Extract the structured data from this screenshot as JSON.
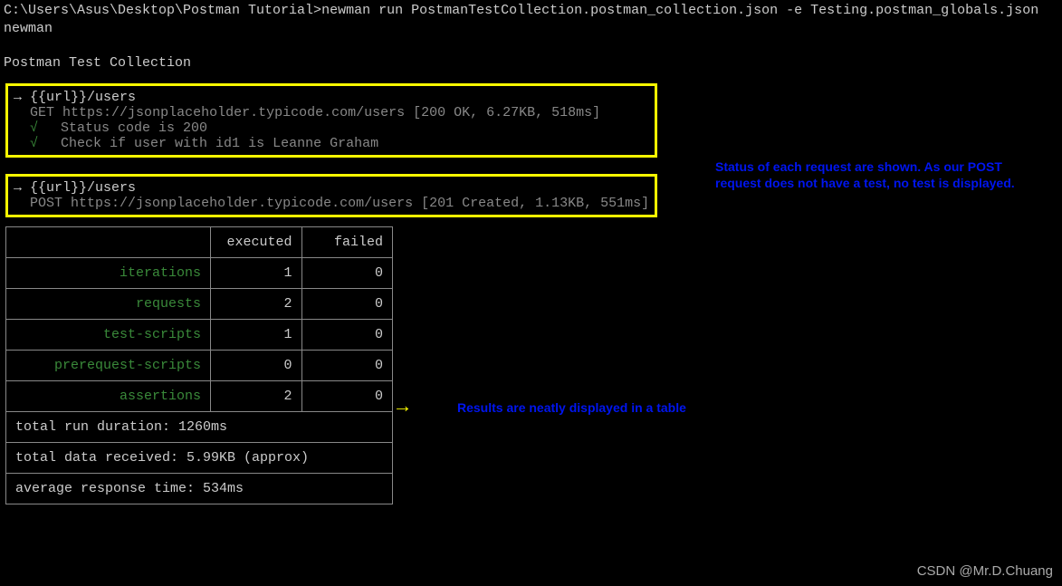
{
  "prompt": {
    "path": "C:\\Users\\Asus\\Desktop\\Postman Tutorial>",
    "command": "newman run PostmanTestCollection.postman_collection.json -e Testing.postman_globals.json",
    "tool": "newman"
  },
  "collection_title": "Postman Test Collection",
  "requests": [
    {
      "path_label": "→ {{url}}/users",
      "method": "GET",
      "url": "https://jsonplaceholder.typicode.com/users",
      "status": "[200 OK, 6.27KB, 518ms]",
      "tests": [
        "Status code is 200",
        "Check if user with id1 is Leanne Graham"
      ]
    },
    {
      "path_label": "→ {{url}}/users",
      "method": "POST",
      "url": "https://jsonplaceholder.typicode.com/users",
      "status": "[201 Created, 1.13KB, 551ms]",
      "tests": []
    }
  ],
  "table": {
    "header_executed": "executed",
    "header_failed": "failed",
    "rows": [
      {
        "label": "iterations",
        "executed": "1",
        "failed": "0"
      },
      {
        "label": "requests",
        "executed": "2",
        "failed": "0"
      },
      {
        "label": "test-scripts",
        "executed": "1",
        "failed": "0"
      },
      {
        "label": "prerequest-scripts",
        "executed": "0",
        "failed": "0"
      },
      {
        "label": "assertions",
        "executed": "2",
        "failed": "0"
      }
    ],
    "footer": [
      "total run duration: 1260ms",
      "total data received: 5.99KB (approx)",
      "average response time: 534ms"
    ]
  },
  "annotations": {
    "status_note": "Status of each request are shown. As our POST request does not have a test, no test is displayed.",
    "table_note": "Results are neatly displayed in a table"
  },
  "watermark": "CSDN @Mr.D.Chuang"
}
